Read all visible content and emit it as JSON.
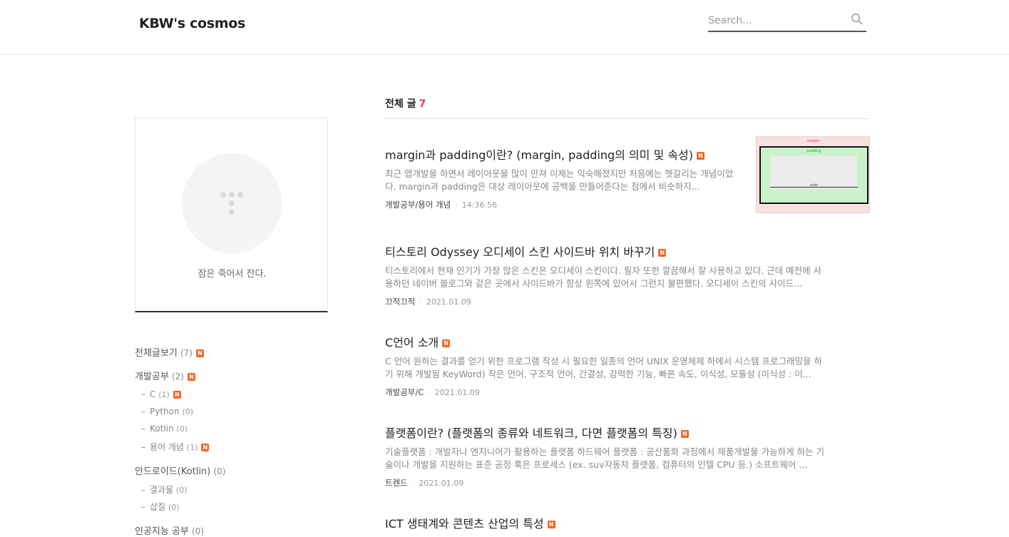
{
  "header": {
    "blog_title": "KBW's cosmos",
    "search_placeholder": "Search..."
  },
  "profile": {
    "description": "잠은 죽어서 잔다."
  },
  "categories": [
    {
      "label": "전체글보기",
      "count": "(7)",
      "new": true
    },
    {
      "label": "개발공부",
      "count": "(2)",
      "new": true
    },
    {
      "label": "C",
      "count": "(1)",
      "new": true,
      "sub": true
    },
    {
      "label": "Python",
      "count": "(0)",
      "new": false,
      "sub": true
    },
    {
      "label": "Kotlin",
      "count": "(0)",
      "new": false,
      "sub": true
    },
    {
      "label": "용어 개념",
      "count": "(1)",
      "new": true,
      "sub": true
    },
    {
      "label": "안드로이드(Kotlin)",
      "count": "(0)",
      "new": false
    },
    {
      "label": "결과물",
      "count": "(0)",
      "new": false,
      "sub": true
    },
    {
      "label": "삽질",
      "count": "(0)",
      "new": false,
      "sub": true
    },
    {
      "label": "인공지능 공부",
      "count": "(0)",
      "new": false
    }
  ],
  "list": {
    "heading": "전체 글",
    "total": "7"
  },
  "badge_text": "N",
  "posts": [
    {
      "title": "margin과 padding이란? (margin, padding의 의미 및 속성)",
      "excerpt": "최근 앱개발을 하면서 레이아웃을 많이 만져 이제는 익숙해졌지만 처음에는 헷갈리는 개념이었다. margin과 padding은 대상 레이아웃에 공백을 만들어준다는 점에서 비슷하지...",
      "category": "개발공부/용어 개념",
      "date": "14:36:56",
      "thumbnail": {
        "margin_label": "margin",
        "padding_label": "padding",
        "width_label": "width"
      }
    },
    {
      "title": "티스토리 Odyssey 오디세이 스킨 사이드바 위치 바꾸기",
      "excerpt": "티스토리에서 현재 인기가 가장 많은 스킨은 오디세이 스킨이다. 필자 또한 깔끔해서 잘 사용하고 있다. 근데 예전에 사용하던 네이버 블로그와 같은 곳에서 사이드바가 항상 왼쪽에 있어서 그런지 불편했다. 오디세이 스킨의 사이드...",
      "category": "끄적끄적",
      "date": "2021.01.09"
    },
    {
      "title": "C언어 소개",
      "excerpt": "C 언어 원하는 결과를 얻기 위한 프로그램 작성 시 필요한 일종의 언어 UNIX 운영체제 하에서 시스템 프로그래밍을 하기 위해 개발됨 KeyWord) 작은 언어, 구조적 언어, 간결성, 강력한 기능, 빠른 속도, 이식성, 모듈성 (이식성 : 이...",
      "category": "개발공부/C",
      "date": "2021.01.09"
    },
    {
      "title": "플랫폼이란? (플랫폼의 종류와 네트워크, 다면 플랫폼의 특징)",
      "excerpt": "기술플랫폼 : 개발자나 엔지니어가 활용하는 플랫폼 하드웨어 플랫폼 : 공산품화 과정에서 제품개발을 가능하게 하는 기술이나 개발을 지원하는 표준 공정 혹은 프로세스 (ex. suv자동차 플랫폼, 컴퓨터의 인텔 CPU 등.) 소프트웨어 ...",
      "category": "트렌드",
      "date": "2021.01.09"
    },
    {
      "title": "ICT 생태계와 콘텐츠 산업의 특성",
      "excerpt": "",
      "category": "",
      "date": ""
    }
  ],
  "colors": {
    "accent_count": "#e53d3d",
    "new_badge": "#f26523",
    "profile_underline": "#333333"
  }
}
